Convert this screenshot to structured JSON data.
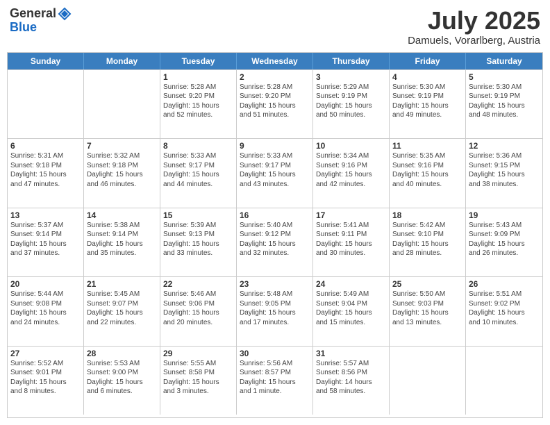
{
  "logo": {
    "general": "General",
    "blue": "Blue"
  },
  "header": {
    "month": "July 2025",
    "location": "Damuels, Vorarlberg, Austria"
  },
  "weekdays": [
    "Sunday",
    "Monday",
    "Tuesday",
    "Wednesday",
    "Thursday",
    "Friday",
    "Saturday"
  ],
  "rows": [
    [
      {
        "day": "",
        "lines": []
      },
      {
        "day": "",
        "lines": []
      },
      {
        "day": "1",
        "lines": [
          "Sunrise: 5:28 AM",
          "Sunset: 9:20 PM",
          "Daylight: 15 hours",
          "and 52 minutes."
        ]
      },
      {
        "day": "2",
        "lines": [
          "Sunrise: 5:28 AM",
          "Sunset: 9:20 PM",
          "Daylight: 15 hours",
          "and 51 minutes."
        ]
      },
      {
        "day": "3",
        "lines": [
          "Sunrise: 5:29 AM",
          "Sunset: 9:19 PM",
          "Daylight: 15 hours",
          "and 50 minutes."
        ]
      },
      {
        "day": "4",
        "lines": [
          "Sunrise: 5:30 AM",
          "Sunset: 9:19 PM",
          "Daylight: 15 hours",
          "and 49 minutes."
        ]
      },
      {
        "day": "5",
        "lines": [
          "Sunrise: 5:30 AM",
          "Sunset: 9:19 PM",
          "Daylight: 15 hours",
          "and 48 minutes."
        ]
      }
    ],
    [
      {
        "day": "6",
        "lines": [
          "Sunrise: 5:31 AM",
          "Sunset: 9:18 PM",
          "Daylight: 15 hours",
          "and 47 minutes."
        ]
      },
      {
        "day": "7",
        "lines": [
          "Sunrise: 5:32 AM",
          "Sunset: 9:18 PM",
          "Daylight: 15 hours",
          "and 46 minutes."
        ]
      },
      {
        "day": "8",
        "lines": [
          "Sunrise: 5:33 AM",
          "Sunset: 9:17 PM",
          "Daylight: 15 hours",
          "and 44 minutes."
        ]
      },
      {
        "day": "9",
        "lines": [
          "Sunrise: 5:33 AM",
          "Sunset: 9:17 PM",
          "Daylight: 15 hours",
          "and 43 minutes."
        ]
      },
      {
        "day": "10",
        "lines": [
          "Sunrise: 5:34 AM",
          "Sunset: 9:16 PM",
          "Daylight: 15 hours",
          "and 42 minutes."
        ]
      },
      {
        "day": "11",
        "lines": [
          "Sunrise: 5:35 AM",
          "Sunset: 9:16 PM",
          "Daylight: 15 hours",
          "and 40 minutes."
        ]
      },
      {
        "day": "12",
        "lines": [
          "Sunrise: 5:36 AM",
          "Sunset: 9:15 PM",
          "Daylight: 15 hours",
          "and 38 minutes."
        ]
      }
    ],
    [
      {
        "day": "13",
        "lines": [
          "Sunrise: 5:37 AM",
          "Sunset: 9:14 PM",
          "Daylight: 15 hours",
          "and 37 minutes."
        ]
      },
      {
        "day": "14",
        "lines": [
          "Sunrise: 5:38 AM",
          "Sunset: 9:14 PM",
          "Daylight: 15 hours",
          "and 35 minutes."
        ]
      },
      {
        "day": "15",
        "lines": [
          "Sunrise: 5:39 AM",
          "Sunset: 9:13 PM",
          "Daylight: 15 hours",
          "and 33 minutes."
        ]
      },
      {
        "day": "16",
        "lines": [
          "Sunrise: 5:40 AM",
          "Sunset: 9:12 PM",
          "Daylight: 15 hours",
          "and 32 minutes."
        ]
      },
      {
        "day": "17",
        "lines": [
          "Sunrise: 5:41 AM",
          "Sunset: 9:11 PM",
          "Daylight: 15 hours",
          "and 30 minutes."
        ]
      },
      {
        "day": "18",
        "lines": [
          "Sunrise: 5:42 AM",
          "Sunset: 9:10 PM",
          "Daylight: 15 hours",
          "and 28 minutes."
        ]
      },
      {
        "day": "19",
        "lines": [
          "Sunrise: 5:43 AM",
          "Sunset: 9:09 PM",
          "Daylight: 15 hours",
          "and 26 minutes."
        ]
      }
    ],
    [
      {
        "day": "20",
        "lines": [
          "Sunrise: 5:44 AM",
          "Sunset: 9:08 PM",
          "Daylight: 15 hours",
          "and 24 minutes."
        ]
      },
      {
        "day": "21",
        "lines": [
          "Sunrise: 5:45 AM",
          "Sunset: 9:07 PM",
          "Daylight: 15 hours",
          "and 22 minutes."
        ]
      },
      {
        "day": "22",
        "lines": [
          "Sunrise: 5:46 AM",
          "Sunset: 9:06 PM",
          "Daylight: 15 hours",
          "and 20 minutes."
        ]
      },
      {
        "day": "23",
        "lines": [
          "Sunrise: 5:48 AM",
          "Sunset: 9:05 PM",
          "Daylight: 15 hours",
          "and 17 minutes."
        ]
      },
      {
        "day": "24",
        "lines": [
          "Sunrise: 5:49 AM",
          "Sunset: 9:04 PM",
          "Daylight: 15 hours",
          "and 15 minutes."
        ]
      },
      {
        "day": "25",
        "lines": [
          "Sunrise: 5:50 AM",
          "Sunset: 9:03 PM",
          "Daylight: 15 hours",
          "and 13 minutes."
        ]
      },
      {
        "day": "26",
        "lines": [
          "Sunrise: 5:51 AM",
          "Sunset: 9:02 PM",
          "Daylight: 15 hours",
          "and 10 minutes."
        ]
      }
    ],
    [
      {
        "day": "27",
        "lines": [
          "Sunrise: 5:52 AM",
          "Sunset: 9:01 PM",
          "Daylight: 15 hours",
          "and 8 minutes."
        ]
      },
      {
        "day": "28",
        "lines": [
          "Sunrise: 5:53 AM",
          "Sunset: 9:00 PM",
          "Daylight: 15 hours",
          "and 6 minutes."
        ]
      },
      {
        "day": "29",
        "lines": [
          "Sunrise: 5:55 AM",
          "Sunset: 8:58 PM",
          "Daylight: 15 hours",
          "and 3 minutes."
        ]
      },
      {
        "day": "30",
        "lines": [
          "Sunrise: 5:56 AM",
          "Sunset: 8:57 PM",
          "Daylight: 15 hours",
          "and 1 minute."
        ]
      },
      {
        "day": "31",
        "lines": [
          "Sunrise: 5:57 AM",
          "Sunset: 8:56 PM",
          "Daylight: 14 hours",
          "and 58 minutes."
        ]
      },
      {
        "day": "",
        "lines": []
      },
      {
        "day": "",
        "lines": []
      }
    ]
  ]
}
